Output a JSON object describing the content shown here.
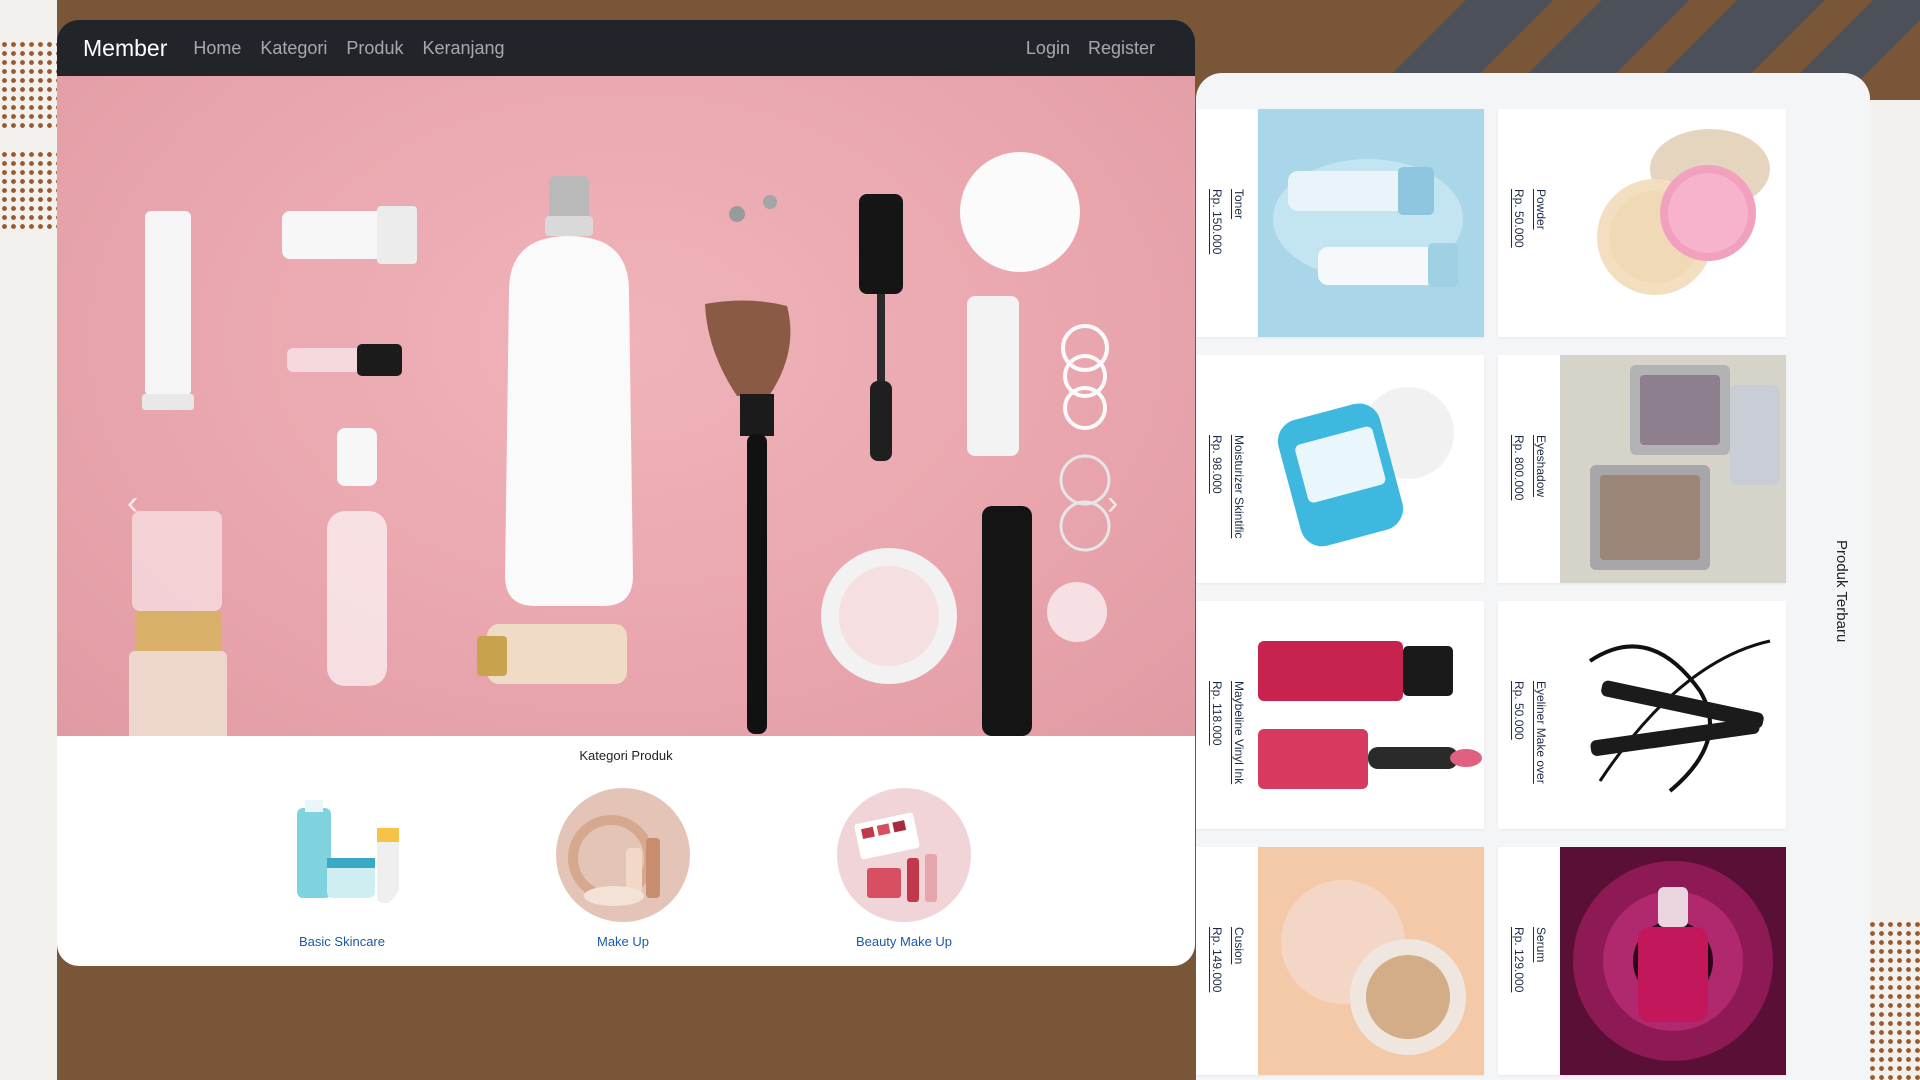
{
  "navbar": {
    "brand": "Member",
    "links": [
      "Home",
      "Kategori",
      "Produk",
      "Keranjang"
    ],
    "login": "Login",
    "register": "Register"
  },
  "categories": {
    "title": "Kategori Produk",
    "items": [
      {
        "label": "Basic Skincare",
        "icon": "skincare-products-image"
      },
      {
        "label": "Make Up",
        "icon": "makeup-products-image"
      },
      {
        "label": "Beauty Make Up",
        "icon": "lipstick-palette-image"
      }
    ]
  },
  "products": {
    "section_label": "Produk Terbaru",
    "items": [
      {
        "name": "Toner",
        "price": "Rp. 150.000",
        "icon": "toner-bottles-image"
      },
      {
        "name": "Powder",
        "price": "Rp. 50.000",
        "icon": "loose-powder-image"
      },
      {
        "name": "Moisturizer Skintific",
        "price": "Rp. 98.000",
        "icon": "moisturizer-jar-image"
      },
      {
        "name": "Eyeshadow",
        "price": "Rp. 800.000",
        "icon": "eyeshadow-palette-image"
      },
      {
        "name": "Maybeline Vinyl Ink",
        "price": "Rp. 118.000",
        "icon": "lip-ink-image"
      },
      {
        "name": "Eyeliner Make over",
        "price": "Rp. 50.000",
        "icon": "eyeliner-pens-image"
      },
      {
        "name": "Cusion",
        "price": "Rp. 149.000",
        "icon": "cushion-compact-image"
      },
      {
        "name": "Serum",
        "price": "Rp. 129.000",
        "icon": "serum-bottle-image"
      }
    ]
  },
  "colors": {
    "navbar_bg": "#212529",
    "background": "#7a5638",
    "hero_pink": "#e9a5ad",
    "link_blue": "#1a5aa8"
  }
}
